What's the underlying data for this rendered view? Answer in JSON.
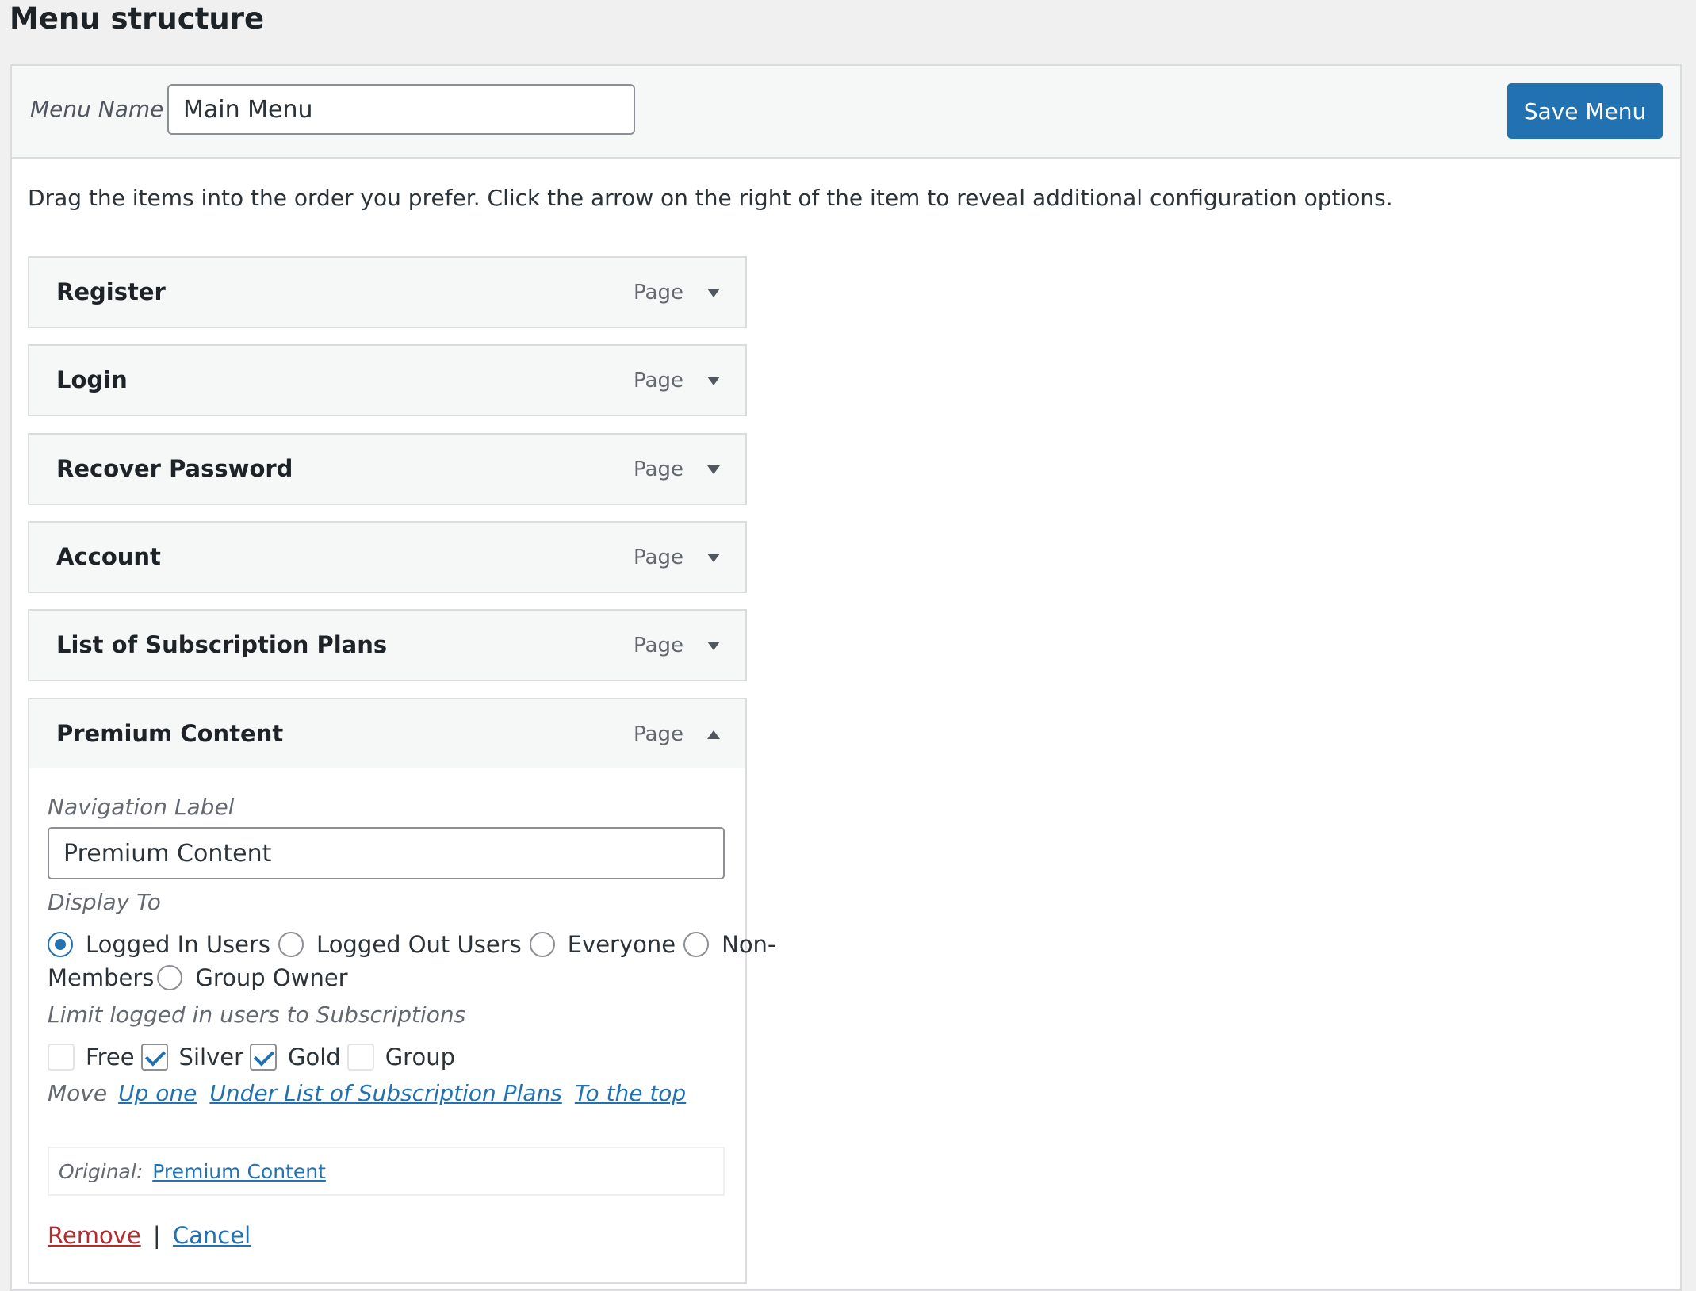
{
  "page": {
    "title": "Menu structure"
  },
  "header": {
    "menu_name_label": "Menu Name",
    "menu_name_value": "Main Menu",
    "save_label": "Save Menu"
  },
  "instructions": "Drag the items into the order you prefer. Click the arrow on the right of the item to reveal additional configuration options.",
  "menu_items": [
    {
      "title": "Register",
      "type": "Page",
      "expanded": false
    },
    {
      "title": "Login",
      "type": "Page",
      "expanded": false
    },
    {
      "title": "Recover Password",
      "type": "Page",
      "expanded": false
    },
    {
      "title": "Account",
      "type": "Page",
      "expanded": false
    },
    {
      "title": "List of Subscription Plans",
      "type": "Page",
      "expanded": false
    },
    {
      "title": "Premium Content",
      "type": "Page",
      "expanded": true
    }
  ],
  "settings": {
    "nav_label_label": "Navigation Label",
    "nav_label_value": "Premium Content",
    "display_to_label": "Display To",
    "display_options": [
      {
        "label": "Logged In Users",
        "checked": true
      },
      {
        "label": "Logged Out Users",
        "checked": false
      },
      {
        "label": "Everyone",
        "checked": false
      },
      {
        "label": "Non-",
        "checked": false
      },
      {
        "label": "Members",
        "checked": false
      },
      {
        "label": "Group Owner",
        "checked": false
      }
    ],
    "limit_label": "Limit logged in users to Subscriptions",
    "subscriptions": [
      {
        "label": "Free",
        "checked": false
      },
      {
        "label": "Silver",
        "checked": true
      },
      {
        "label": "Gold",
        "checked": true
      },
      {
        "label": "Group",
        "checked": false
      }
    ],
    "move_label": "Move",
    "move_links": [
      "Up one",
      "Under List of Subscription Plans",
      "To the top"
    ],
    "original_label": "Original:",
    "original_link": "Premium Content",
    "remove_label": "Remove",
    "separator": "|",
    "cancel_label": "Cancel"
  }
}
